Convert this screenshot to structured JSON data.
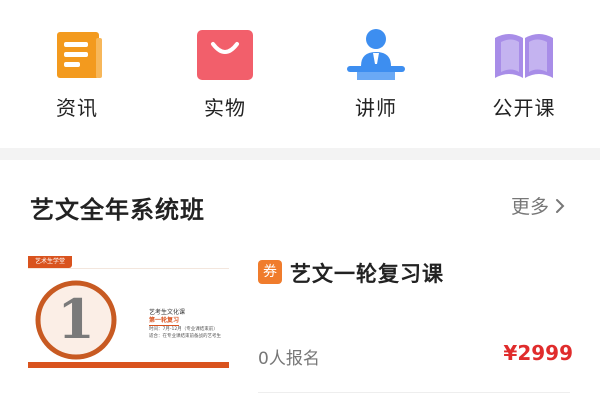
{
  "nav": {
    "items": [
      {
        "label": "资讯",
        "icon": "news-icon",
        "color": "#f39a1e"
      },
      {
        "label": "实物",
        "icon": "shopping-bag-icon",
        "color": "#f25f6b"
      },
      {
        "label": "讲师",
        "icon": "lecturer-icon",
        "color": "#3d8ef0"
      },
      {
        "label": "公开课",
        "icon": "open-book-icon",
        "color": "#a88de8"
      }
    ]
  },
  "section": {
    "title": "艺文全年系统班",
    "more_label": "更多"
  },
  "course": {
    "coupon_badge": "券",
    "title": "艺文一轮复习课",
    "enroll": "0人报名",
    "price": "¥2999",
    "thumbnail": {
      "brand": "艺术生学堂",
      "big_number": "1",
      "line1": "艺考生文化课",
      "line2": "第一轮复习",
      "line3": "时间：7月-12月（专业课结束前）",
      "line4": "适合：在专业课结束前备战的艺考生"
    }
  },
  "colors": {
    "accent_red": "#e02c2c",
    "badge_orange": "#f07c2c",
    "thumb_orange": "#d9531e"
  }
}
